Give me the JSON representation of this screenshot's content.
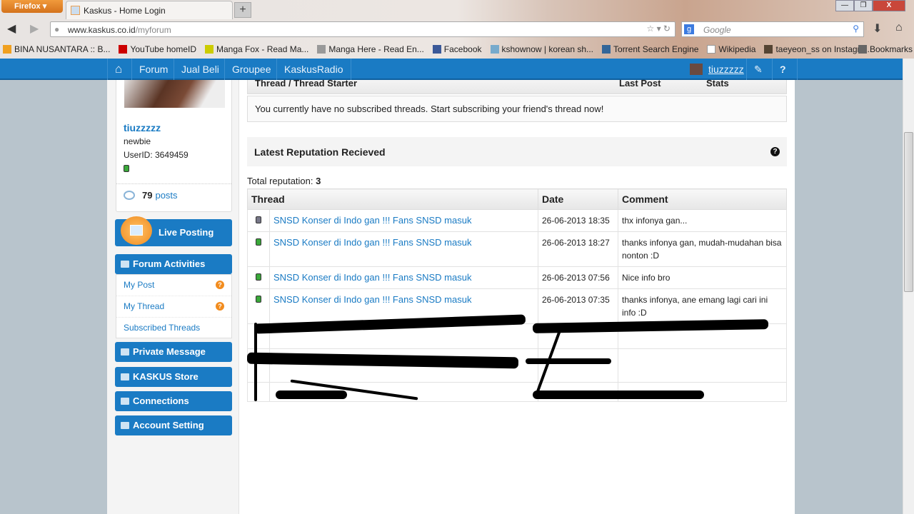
{
  "browser": {
    "menu_button": "Firefox",
    "tab_title": "Kaskus - Home Login",
    "new_tab": "+",
    "url_domain": "www.kaskus.co.id",
    "url_path": "/myforum",
    "search_placeholder": "Google",
    "bookmarks": [
      "BINA NUSANTARA :: B...",
      "YouTube homeID",
      "Manga Fox - Read Ma...",
      "Manga Here - Read En...",
      "Facebook",
      "kshownow | korean sh...",
      "Torrent Search Engine",
      "Wikipedia",
      "taeyeon_ss on Instagra..."
    ],
    "bookmarks_menu": "Bookmarks"
  },
  "topnav": {
    "items": [
      "Forum",
      "Jual Beli",
      "Groupee",
      "KaskusRadio"
    ],
    "username": "tiuzzzzz"
  },
  "profile": {
    "username": "tiuzzzzz",
    "rank": "newbie",
    "user_id": "UserID: 3649459",
    "post_count": "79",
    "posts_label": "posts"
  },
  "sidebar": {
    "live_posting": "Live Posting",
    "forum_activities": "Forum Activities",
    "sub_items": [
      "My Post",
      "My Thread",
      "Subscribed Threads"
    ],
    "private_message": "Private Message",
    "store": "KASKUS Store",
    "connections": "Connections",
    "account_setting": "Account Setting"
  },
  "subscribed": {
    "col_thread": "Thread / Thread Starter",
    "col_last_post": "Last Post",
    "col_stats": "Stats",
    "empty_message": "You currently have no subscribed threads. Start subscribing your friend's thread now!"
  },
  "reputation": {
    "title": "Latest Reputation Recieved",
    "total_label": "Total reputation:",
    "total_value": "3",
    "columns": [
      "Thread",
      "Date",
      "Comment"
    ],
    "rows": [
      {
        "status": "gray",
        "thread": "SNSD Konser di Indo gan !!! Fans SNSD masuk",
        "date": "26-06-2013 18:35",
        "comment": "thx infonya gan..."
      },
      {
        "status": "green",
        "thread": "SNSD Konser di Indo gan !!! Fans SNSD masuk",
        "date": "26-06-2013 18:27",
        "comment": "thanks infonya gan, mudah-mudahan bisa nonton :D"
      },
      {
        "status": "green",
        "thread": "SNSD Konser di Indo gan !!! Fans SNSD masuk",
        "date": "26-06-2013 07:56",
        "comment": "Nice info bro"
      },
      {
        "status": "green",
        "thread": "SNSD Konser di Indo gan !!! Fans SNSD masuk",
        "date": "26-06-2013 07:35",
        "comment": "thanks infonya, ane emang lagi cari ini info :D"
      }
    ]
  },
  "colors": {
    "brand_blue": "#1a7bc4",
    "online_green": "#3aa83a",
    "neutral_gray": "#777788",
    "badge_orange": "#f28c1e"
  }
}
